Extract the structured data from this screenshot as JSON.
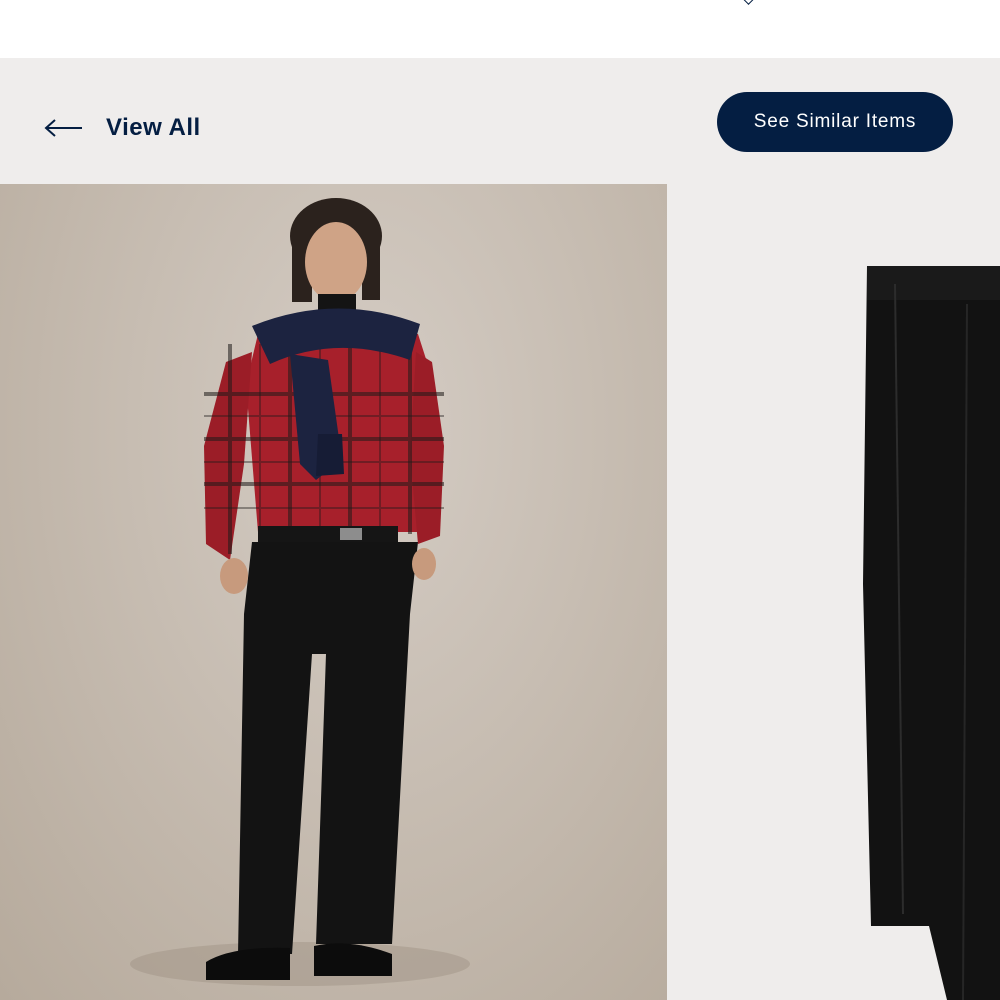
{
  "nav": {
    "back_label": "View All",
    "similar_label": "See Similar Items"
  },
  "icons": {
    "back": "arrow-left-icon",
    "top_caret": "chevron-down-icon"
  },
  "colors": {
    "navy": "#041e42",
    "page_background": "#efedec"
  }
}
